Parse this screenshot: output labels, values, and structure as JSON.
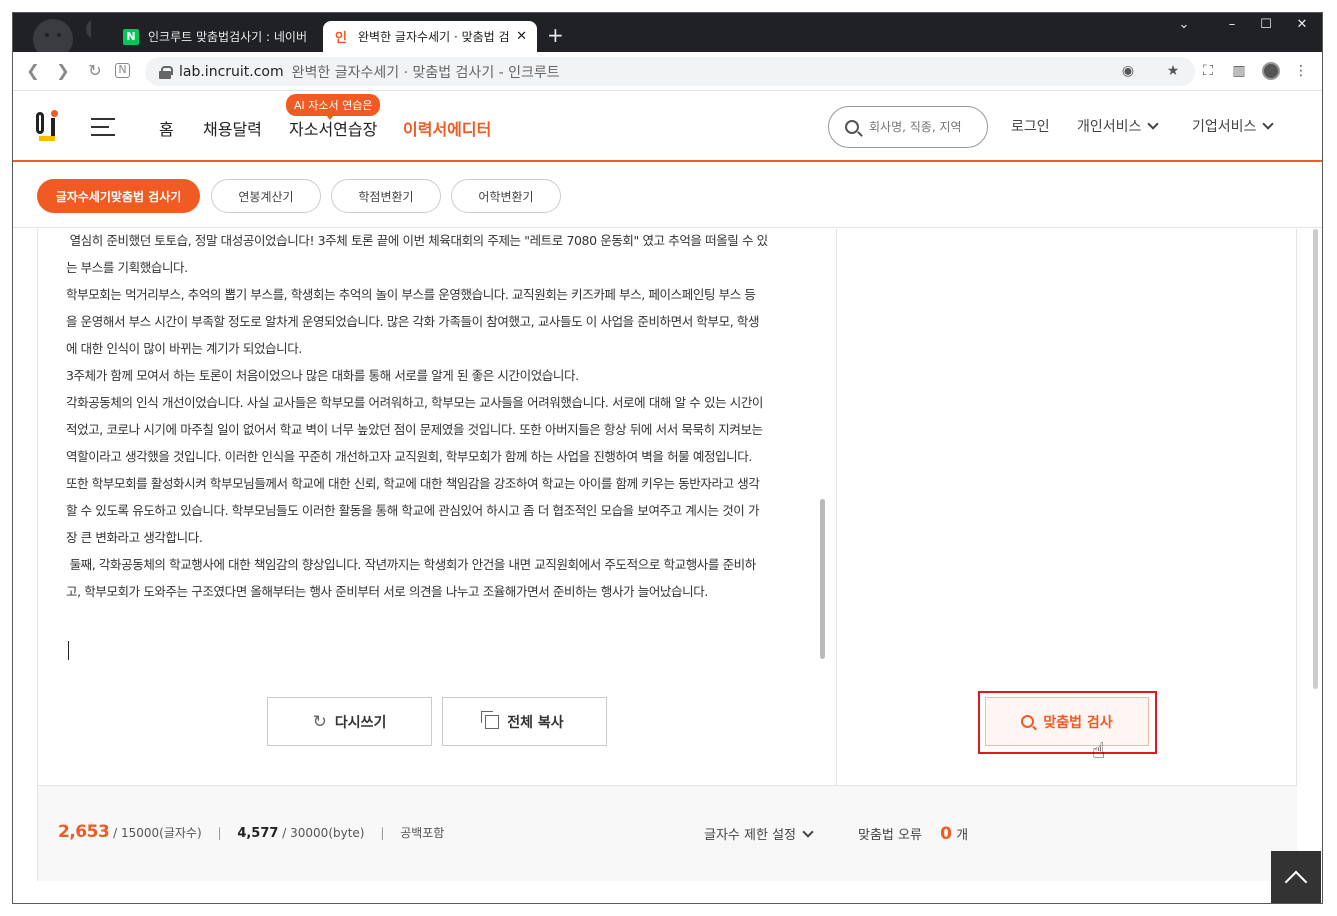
{
  "browser": {
    "tabs": [
      {
        "favicon": "N",
        "title": "인크루트 맞춤법검사기 : 네이버"
      },
      {
        "favicon": "인",
        "title": "완벽한 글자수세기 · 맞춤법 검사"
      }
    ],
    "new_tab": "+",
    "window_controls": {
      "dropdown": "⌄",
      "minimize": "–",
      "maximize": "☐",
      "close": "✕"
    },
    "url_host": "lab.incruit.com",
    "url_title": "완벽한 글자수세기 · 맞춤법 검사기 - 인크루트"
  },
  "header": {
    "logo_text": "인",
    "nav": [
      "홈",
      "채용달력",
      "자소서연습장",
      "이력서에디터"
    ],
    "ai_badge": "AI 자소서 연습은",
    "search_placeholder": "회사명, 직종, 지역",
    "login": "로그인",
    "personal": "개인서비스",
    "business": "기업서비스"
  },
  "subtabs": [
    "글자수세기맞춤법 검사기",
    "연봉계산기",
    "학점변환기",
    "어학변환기"
  ],
  "editor": {
    "lines": [
      " 열심히 준비했던 토토습, 정말 대성공이었습니다! 3주체 토론 끝에 이번 체육대회의 주제는 \"레트로 7080 운동회\" 였고 추억을 떠올릴 수 있",
      "는 부스를 기획했습니다.",
      "학부모회는 먹거리부스, 추억의 뽑기 부스를, 학생회는 추억의 놀이 부스를 운영했습니다. 교직원회는 키즈카페 부스, 페이스페인팅 부스 등",
      "을 운영해서 부스 시간이 부족할 정도로 알차게 운영되었습니다. 많은 각화 가족들이 참여했고, 교사들도 이 사업을 준비하면서 학부모, 학생",
      "에 대한 인식이 많이 바뀌는 계기가 되었습니다.",
      "3주체가 함께 모여서 하는 토론이 처음이었으나 많은 대화를 통해 서로를 알게 된 좋은 시간이었습니다.",
      "",
      "각화공동체의 인식 개선이었습니다. 사실 교사들은 학부모를 어려워하고, 학부모는 교사들을 어려워했습니다. 서로에 대해 알 수 있는 시간이",
      "적었고, 코로나 시기에 마주칠 일이 없어서 학교 벽이 너무 높았던 점이 문제였을 것입니다. 또한 아버지들은 항상 뒤에 서서 묵묵히 지켜보는",
      "역할이라고 생각했을 것입니다. 이러한 인식을 꾸준히 개선하고자 교직원회, 학부모회가 함께 하는 사업을 진행하여 벽을 허물 예정입니다.",
      "또한 학부모회를 활성화시켜 학부모님들께서 학교에 대한 신뢰, 학교에 대한 책임감을 강조하여 학교는 아이를 함께 키우는 동반자라고 생각",
      "할 수 있도록 유도하고 있습니다. 학부모님들도 이러한 활동을 통해 학교에 관심있어 하시고 좀 더 협조적인 모습을 보여주고 계시는 것이 가",
      "장 큰 변화라고 생각합니다.",
      " 둘째, 각화공동체의 학교행사에 대한 책임감의 향상입니다. 작년까지는 학생회가 안건을 내면 교직원회에서 주도적으로 학교행사를 준비하",
      "고, 학부모회가 도와주는 구조였다면 올해부터는 행사 준비부터 서로 의견을 나누고 조율해가면서 준비하는 행사가 늘어났습니다."
    ],
    "rewrite_button": "다시쓰기",
    "copy_button": "전체 복사"
  },
  "spell_check_button": "맞춤법 검사",
  "footer": {
    "char_count": "2,653",
    "char_limit": "/ 15000(글자수)",
    "byte_count": "4,577",
    "byte_limit": "/ 30000(byte)",
    "space_note": "공백포함",
    "limit_setting": "글자수 제한 설정",
    "error_label": "맞춤법 오류",
    "error_count": "0",
    "error_unit": "개"
  }
}
